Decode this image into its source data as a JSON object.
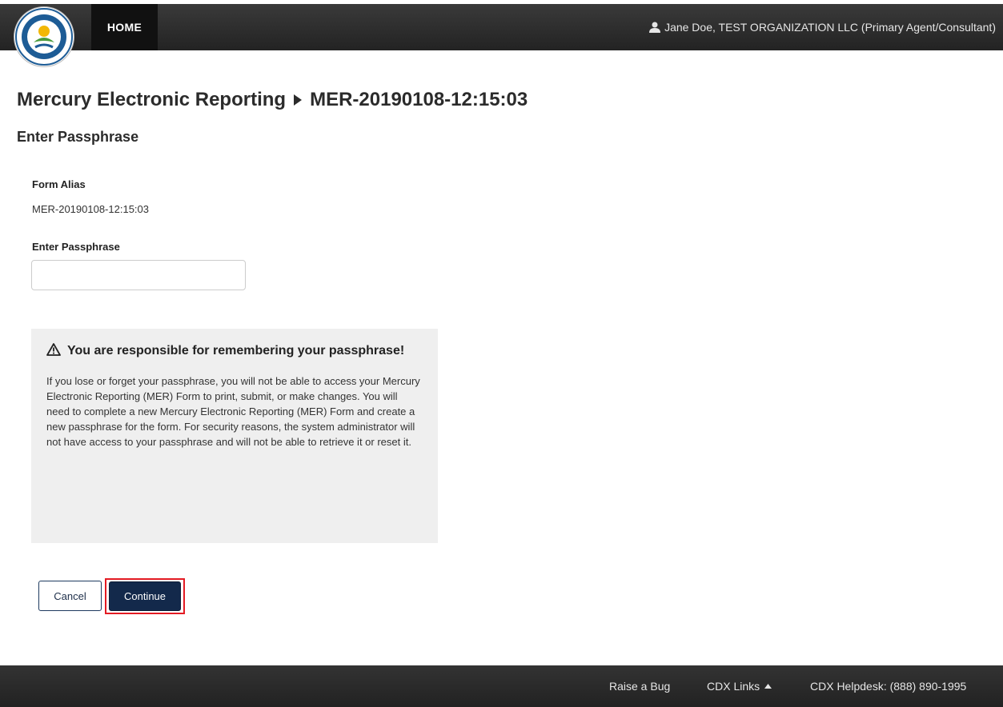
{
  "navbar": {
    "home_label": "HOME",
    "user_label": "Jane Doe, TEST ORGANIZATION LLC (Primary Agent/Consultant)",
    "logo_icon": "epa-seal-logo",
    "user_icon": "user-icon"
  },
  "page": {
    "title_part1": "Mercury Electronic Reporting",
    "title_part2": "MER-20190108-12:15:03",
    "subtitle": "Enter Passphrase"
  },
  "form": {
    "alias_label": "Form Alias",
    "alias_value": "MER-20190108-12:15:03",
    "passphrase_label": "Enter Passphrase",
    "passphrase_value": ""
  },
  "warning": {
    "icon": "warning-triangle-icon",
    "title": "You are responsible for remembering your passphrase!",
    "body": "If you lose or forget your passphrase, you will not be able to access your Mercury Electronic Reporting (MER) Form to print, submit, or make changes. You will need to complete a new Mercury Electronic Reporting (MER) Form and create a new passphrase for the form. For security reasons, the system administrator will not have access to your passphrase and will not be able to retrieve it or reset it."
  },
  "buttons": {
    "cancel_label": "Cancel",
    "continue_label": "Continue"
  },
  "footer": {
    "raise_bug": "Raise a Bug",
    "cdx_links": "CDX Links",
    "helpdesk": "CDX Helpdesk: (888) 890-1995"
  },
  "colors": {
    "navbar": "#2b2b2b",
    "primary_button": "#13294b",
    "highlight": "#e31b23",
    "warning_bg": "#efefef"
  }
}
